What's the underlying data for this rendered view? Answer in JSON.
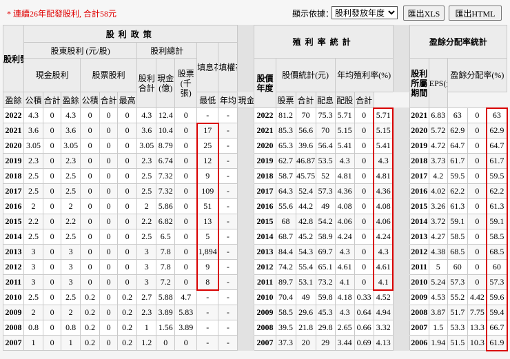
{
  "toolbar": {
    "notice": "* 連續26年配發股利, 合計58元",
    "sort_label": "顯示依據：",
    "sort_selected": "股利發放年度",
    "xls_label": "匯出XLS",
    "html_label": "匯出HTML"
  },
  "headers": {
    "policy": "股利政策",
    "dividend_year": "股利發放年度",
    "shareholder_div": "股東股利 (元/股)",
    "total_div": "股利總計",
    "fill_days": "填息花費日數",
    "fill_right_days": "填權花費日數",
    "yield_stats": "殖利率統計",
    "price_year": "股價年度",
    "price_stats": "股價統計(元)",
    "avg_yield": "年均殖利率(%)",
    "payout_stats": "盈餘分配率統計",
    "div_period": "股利所屬期間",
    "eps": "EPS(元)",
    "payout_pct": "盈餘分配率(%)",
    "cash_div": "現金股利",
    "stock_div": "股票股利",
    "surplus": "盈餘",
    "reserve": "公積",
    "subtotal": "合計",
    "div_total": "股利合計",
    "cash_amt": "現金(億)",
    "stock_amt": "股票(千張)",
    "high": "最高",
    "low": "最低",
    "avg": "年均",
    "cash": "現金",
    "stock": "股票",
    "payout_d": "配息",
    "payout_s": "配股"
  },
  "rows": [
    [
      "2022",
      "4.3",
      "0",
      "4.3",
      "0",
      "0",
      "0",
      "4.3",
      "12.4",
      "0",
      "-",
      "-",
      "2022",
      "81.2",
      "70",
      "75.3",
      "5.71",
      "0",
      "5.71",
      "2021",
      "6.83",
      "63",
      "0",
      "63"
    ],
    [
      "2021",
      "3.6",
      "0",
      "3.6",
      "0",
      "0",
      "0",
      "3.6",
      "10.4",
      "0",
      "17",
      "-",
      "2021",
      "85.3",
      "56.6",
      "70",
      "5.15",
      "0",
      "5.15",
      "2020",
      "5.72",
      "62.9",
      "0",
      "62.9"
    ],
    [
      "2020",
      "3.05",
      "0",
      "3.05",
      "0",
      "0",
      "0",
      "3.05",
      "8.79",
      "0",
      "25",
      "-",
      "2020",
      "65.3",
      "39.6",
      "56.4",
      "5.41",
      "0",
      "5.41",
      "2019",
      "4.72",
      "64.7",
      "0",
      "64.7"
    ],
    [
      "2019",
      "2.3",
      "0",
      "2.3",
      "0",
      "0",
      "0",
      "2.3",
      "6.74",
      "0",
      "12",
      "-",
      "2019",
      "62.7",
      "46.87",
      "53.5",
      "4.3",
      "0",
      "4.3",
      "2018",
      "3.73",
      "61.7",
      "0",
      "61.7"
    ],
    [
      "2018",
      "2.5",
      "0",
      "2.5",
      "0",
      "0",
      "0",
      "2.5",
      "7.32",
      "0",
      "9",
      "-",
      "2018",
      "58.7",
      "45.75",
      "52",
      "4.81",
      "0",
      "4.81",
      "2017",
      "4.2",
      "59.5",
      "0",
      "59.5"
    ],
    [
      "2017",
      "2.5",
      "0",
      "2.5",
      "0",
      "0",
      "0",
      "2.5",
      "7.32",
      "0",
      "109",
      "-",
      "2017",
      "64.3",
      "52.4",
      "57.3",
      "4.36",
      "0",
      "4.36",
      "2016",
      "4.02",
      "62.2",
      "0",
      "62.2"
    ],
    [
      "2016",
      "2",
      "0",
      "2",
      "0",
      "0",
      "0",
      "2",
      "5.86",
      "0",
      "51",
      "-",
      "2016",
      "55.6",
      "44.2",
      "49",
      "4.08",
      "0",
      "4.08",
      "2015",
      "3.26",
      "61.3",
      "0",
      "61.3"
    ],
    [
      "2015",
      "2.2",
      "0",
      "2.2",
      "0",
      "0",
      "0",
      "2.2",
      "6.82",
      "0",
      "13",
      "-",
      "2015",
      "68",
      "42.8",
      "54.2",
      "4.06",
      "0",
      "4.06",
      "2014",
      "3.72",
      "59.1",
      "0",
      "59.1"
    ],
    [
      "2014",
      "2.5",
      "0",
      "2.5",
      "0",
      "0",
      "0",
      "2.5",
      "6.5",
      "0",
      "5",
      "-",
      "2014",
      "68.7",
      "45.2",
      "58.9",
      "4.24",
      "0",
      "4.24",
      "2013",
      "4.27",
      "58.5",
      "0",
      "58.5"
    ],
    [
      "2013",
      "3",
      "0",
      "3",
      "0",
      "0",
      "0",
      "3",
      "7.8",
      "0",
      "1,894",
      "-",
      "2013",
      "84.4",
      "54.3",
      "69.7",
      "4.3",
      "0",
      "4.3",
      "2012",
      "4.38",
      "68.5",
      "0",
      "68.5"
    ],
    [
      "2012",
      "3",
      "0",
      "3",
      "0",
      "0",
      "0",
      "3",
      "7.8",
      "0",
      "9",
      "-",
      "2012",
      "74.2",
      "55.4",
      "65.1",
      "4.61",
      "0",
      "4.61",
      "2011",
      "5",
      "60",
      "0",
      "60"
    ],
    [
      "2011",
      "3",
      "0",
      "3",
      "0",
      "0",
      "0",
      "3",
      "7.2",
      "0",
      "8",
      "-",
      "2011",
      "89.7",
      "53.1",
      "73.2",
      "4.1",
      "0",
      "4.1",
      "2010",
      "5.24",
      "57.3",
      "0",
      "57.3"
    ],
    [
      "2010",
      "2.5",
      "0",
      "2.5",
      "0.2",
      "0",
      "0.2",
      "2.7",
      "5.88",
      "4.7",
      "-",
      "-",
      "2010",
      "70.4",
      "49",
      "59.8",
      "4.18",
      "0.33",
      "4.52",
      "2009",
      "4.53",
      "55.2",
      "4.42",
      "59.6"
    ],
    [
      "2009",
      "2",
      "0",
      "2",
      "0.2",
      "0",
      "0.2",
      "2.3",
      "3.89",
      "5.83",
      "-",
      "-",
      "2009",
      "58.5",
      "29.6",
      "45.3",
      "4.3",
      "0.64",
      "4.94",
      "2008",
      "3.87",
      "51.7",
      "7.75",
      "59.4"
    ],
    [
      "2008",
      "0.8",
      "0",
      "0.8",
      "0.2",
      "0",
      "0.2",
      "1",
      "1.56",
      "3.89",
      "-",
      "-",
      "2008",
      "39.5",
      "21.8",
      "29.8",
      "2.65",
      "0.66",
      "3.32",
      "2007",
      "1.5",
      "53.3",
      "13.3",
      "66.7"
    ],
    [
      "2007",
      "1",
      "0",
      "1",
      "0.2",
      "0",
      "0.2",
      "1.2",
      "0",
      "0",
      "-",
      "-",
      "2007",
      "37.3",
      "20",
      "29",
      "3.44",
      "0.69",
      "4.13",
      "2006",
      "1.94",
      "51.5",
      "10.3",
      "61.9"
    ]
  ]
}
